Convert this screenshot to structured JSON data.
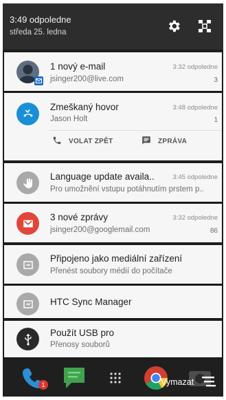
{
  "status": {
    "time": "3:49 odpoledne",
    "date": "středa 25. ledna"
  },
  "notifications": [
    {
      "title": "1 nový e-mail",
      "subtitle": "jsinger200@live.com",
      "time": "3:32 odpoledne",
      "count": "3",
      "icon": "contact-avatar-icon"
    },
    {
      "title": "Zmeškaný hovor",
      "subtitle": "Jason Holt",
      "time": "3:48 odpoledne",
      "count": "1",
      "icon": "missed-call-icon",
      "color": "#1a8fd8",
      "actions": [
        {
          "label": "VOLAT ZPĚT",
          "icon": "phone-icon"
        },
        {
          "label": "ZPRÁVA",
          "icon": "message-icon"
        }
      ]
    },
    {
      "title": "Language update availa..",
      "subtitle": "Pro umožnění vstupu potáhnutím prstem p..",
      "time": "3:45 odpoledne",
      "icon": "swipe-hand-icon",
      "color": "#a9a9a9"
    },
    {
      "title": "3 nové zprávy",
      "subtitle": "jsinger200@googlemail.com",
      "time": "3:32 odpoledne",
      "count": "86",
      "icon": "gmail-icon",
      "color": "#e2463a"
    },
    {
      "title": "Připojeno jako mediální zařízení",
      "subtitle": "Přenést soubory médií do počítače",
      "icon": "usb-media-icon",
      "color": "#a9a9a9"
    },
    {
      "title": "HTC Sync Manager",
      "icon": "sync-manager-icon",
      "color": "#a9a9a9"
    },
    {
      "title": "Použít USB pro",
      "subtitle": "Přenosy souborů",
      "icon": "usb-icon",
      "color": "#2a2a2a"
    }
  ],
  "dock": {
    "clear_label": "Vymazat",
    "phone_badge": "1"
  }
}
